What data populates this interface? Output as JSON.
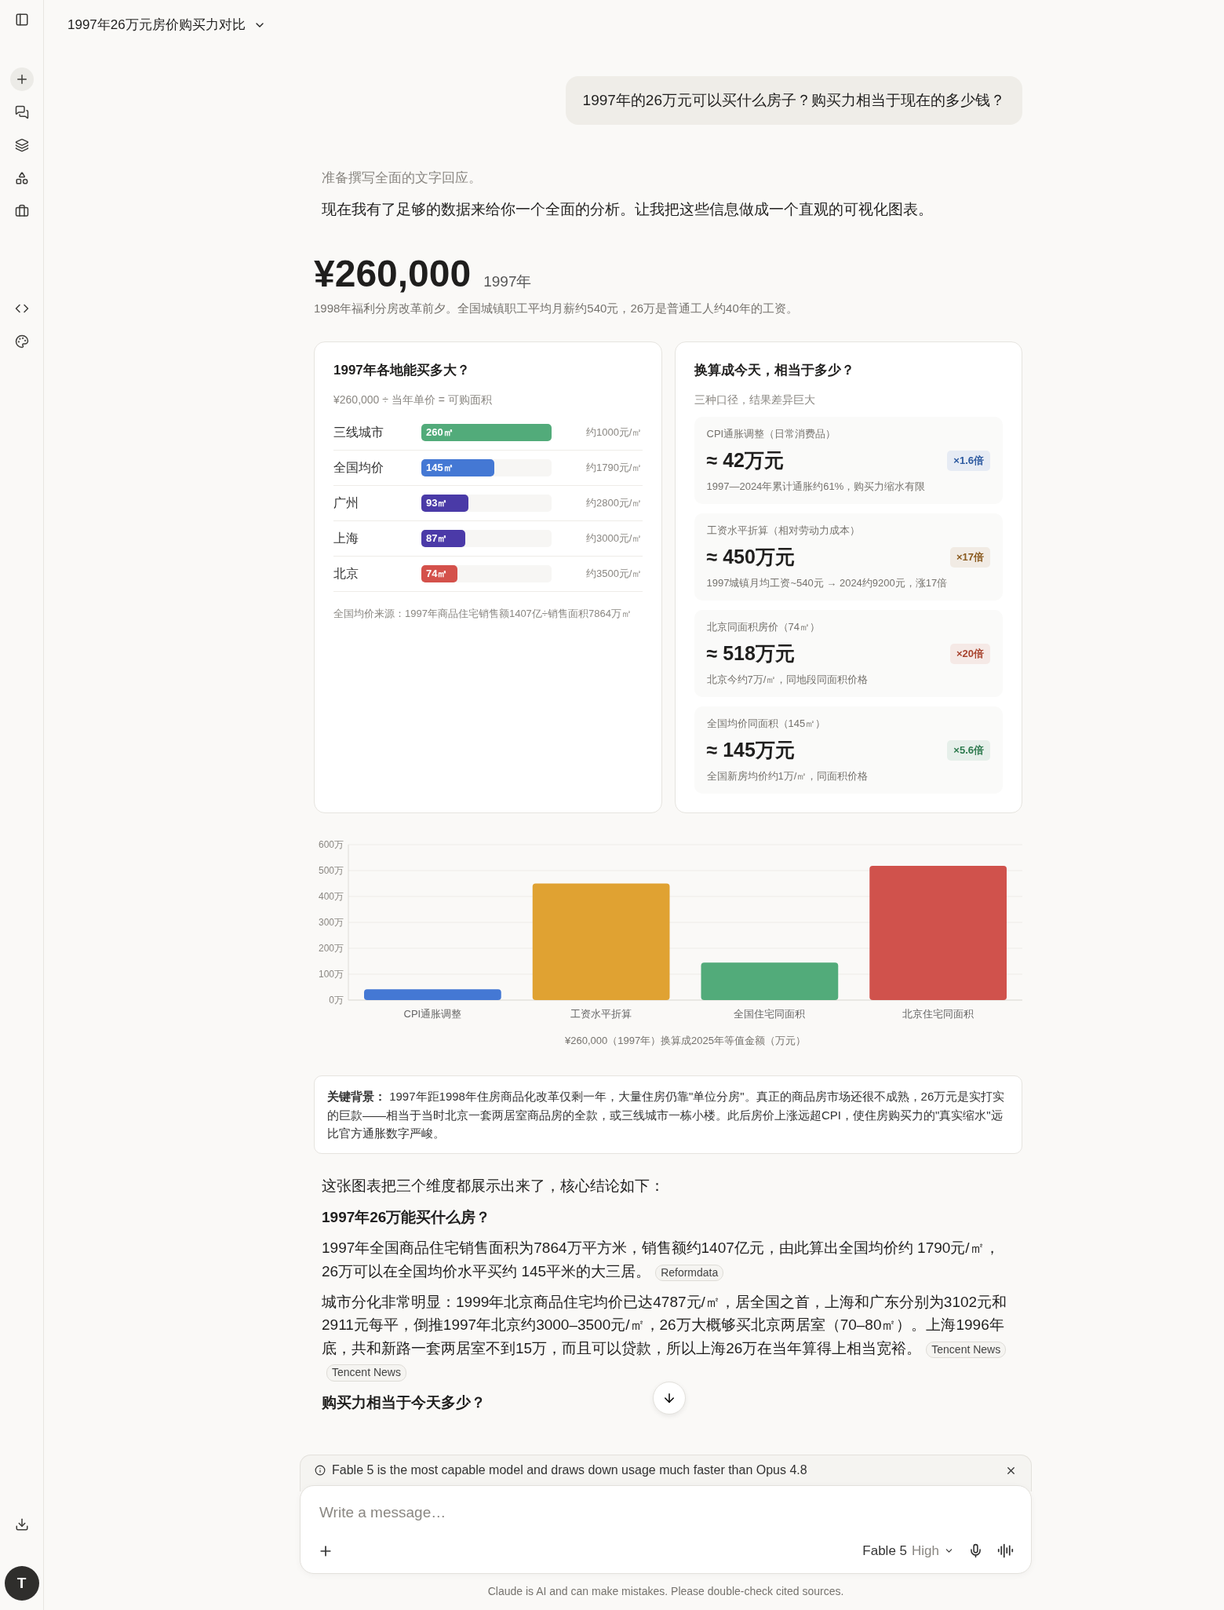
{
  "header": {
    "title": "1997年26万元房价购买力对比"
  },
  "user_message": "1997年的26万元可以买什么房子？购买力相当于现在的多少钱？",
  "thinking": "准备撰写全面的文字回应。",
  "intro": "现在我有了足够的数据来给你一个全面的分析。让我把这些信息做成一个直观的可视化图表。",
  "hero": {
    "amount": "¥260,000",
    "year": "1997年",
    "note": "1998年福利分房改革前夕。全国城镇职工平均月薪约540元，26万是普通工人约40年的工资。"
  },
  "area_card": {
    "title": "1997年各地能买多大？",
    "subtitle": "¥260,000 ÷ 当年单价 = 可购面积",
    "rows": [
      {
        "city": "三线城市",
        "area": "260㎡",
        "price": "约1000元/㎡",
        "level": 1.0,
        "color": "#52ab7a"
      },
      {
        "city": "全国均价",
        "area": "145㎡",
        "price": "约1790元/㎡",
        "level": 0.56,
        "color": "#4478d4"
      },
      {
        "city": "广州",
        "area": "93㎡",
        "price": "约2800元/㎡",
        "level": 0.36,
        "color": "#4a3aa7"
      },
      {
        "city": "上海",
        "area": "87㎡",
        "price": "约3000元/㎡",
        "level": 0.34,
        "color": "#4b3aa8"
      },
      {
        "city": "北京",
        "area": "74㎡",
        "price": "约3500元/㎡",
        "level": 0.28,
        "color": "#d4514b"
      }
    ],
    "footnote": "全国均价来源：1997年商品住宅销售额1407亿÷销售面积7864万㎡"
  },
  "convert_card": {
    "title": "换算成今天，相当于多少？",
    "subtitle": "三种口径，结果差异巨大",
    "items": [
      {
        "label": "CPI通胀调整（日常消费品）",
        "value": "≈ 42万元",
        "note": "1997—2024年累计通胀约61%，购买力缩水有限",
        "badge": "×1.6倍",
        "color": "#2d5aa0"
      },
      {
        "label": "工资水平折算（相对劳动力成本）",
        "value": "≈ 450万元",
        "note": "1997城镇月均工资~540元 → 2024约9200元，涨17倍",
        "badge": "×17倍",
        "color": "#8a5a1e"
      },
      {
        "label": "北京同面积房价（74㎡）",
        "value": "≈ 518万元",
        "note": "北京今约7万/㎡，同地段同面积价格",
        "badge": "×20倍",
        "color": "#a8442f"
      },
      {
        "label": "全国均价同面积（145㎡）",
        "value": "≈ 145万元",
        "note": "全国新房均价约1万/㎡，同面积价格",
        "badge": "×5.6倍",
        "color": "#2e7a4e"
      }
    ]
  },
  "chart_data": {
    "type": "bar",
    "xlabel": "¥260,000（1997年）换算成2025年等值金额（万元）",
    "categories": [
      "CPI通胀调整",
      "工资水平折算",
      "全国住宅同面积",
      "北京住宅同面积"
    ],
    "series": [
      {
        "color": "#4478d4",
        "values": [
          42,
          null,
          null,
          null
        ]
      },
      {
        "color": "#e0a232",
        "values": [
          null,
          450,
          null,
          null
        ]
      },
      {
        "color": "#52ab7a",
        "values": [
          null,
          null,
          145,
          null
        ]
      },
      {
        "color": "#d0524c",
        "values": [
          null,
          null,
          null,
          518
        ]
      }
    ],
    "grid": true,
    "ylim": [
      0,
      600
    ],
    "yticks": [
      {
        "value": 0,
        "label": "0万"
      },
      {
        "value": 100,
        "label": "100万"
      },
      {
        "value": 200,
        "label": "200万"
      },
      {
        "value": 300,
        "label": "300万"
      },
      {
        "value": 400,
        "label": "400万"
      },
      {
        "value": 500,
        "label": "500万"
      },
      {
        "value": 600,
        "label": "600万"
      }
    ]
  },
  "key_background": "**关键背景：** 1997年距1998年住房商品化改革仅剩一年，大量住房仍靠\"单位分房\"。真正的商品房市场还很不成熟，26万元是实打实的巨款——相当于当时北京一套两居室商品房的全款，或三线城市一栋小楼。此后房价上涨远超CPI，使住房购买力的\"真实缩水\"远比官方通胀数字严峻。",
  "answer": [
    {
      "kind": "paragraph",
      "text": "这张图表把三个维度都展示出来了，核心结论如下："
    },
    {
      "kind": "heading",
      "text": "1997年26万能买什么房？"
    },
    {
      "kind": "paragraph",
      "text": "1997年全国商品住宅销售面积为7864万平方米，销售额约1407亿元，由此算出全国均价约 1790元/㎡，26万可以在全国均价水平买约 145平米的大三居。",
      "sources": [
        "Reformdata"
      ]
    },
    {
      "kind": "paragraph",
      "text": "城市分化非常明显：1999年北京商品住宅均价已达4787元/㎡，居全国之首，上海和广东分别为3102元和2911元每平，倒推1997年北京约3000–3500元/㎡，26万大概够买北京两居室（70–80㎡）。上海1996年底，共和新路一套两居室不到15万，而且可以贷款，所以上海26万在当年算得上相当宽裕。",
      "sources": [
        "Tencent News",
        "Tencent News"
      ]
    },
    {
      "kind": "heading",
      "text": "购买力相当于今天多少？"
    }
  ],
  "notice": "Fable 5 is the most capable model and draws down usage much faster than Opus 4.8",
  "composer": {
    "placeholder": "Write a message…",
    "model": "Fable 5",
    "effort": "High"
  },
  "disclaimer": "Claude is AI and can make mistakes. Please double-check cited sources.",
  "avatar": "T"
}
